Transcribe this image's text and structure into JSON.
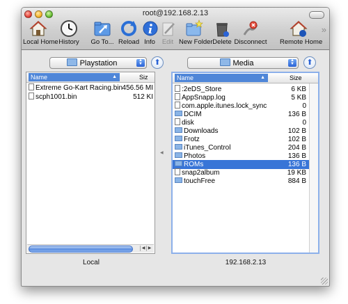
{
  "window": {
    "title": "root@192.168.2.13"
  },
  "toolbar": {
    "items": [
      {
        "label": "Local Home",
        "icon": "house-icon"
      },
      {
        "label": "History",
        "icon": "clock-icon"
      },
      {
        "label": "Go To...",
        "icon": "folder-goto-icon"
      },
      {
        "label": "Reload",
        "icon": "reload-icon"
      },
      {
        "label": "Info",
        "icon": "info-icon"
      },
      {
        "label": "Edit",
        "icon": "edit-icon"
      },
      {
        "label": "New Folder",
        "icon": "new-folder-icon"
      },
      {
        "label": "Delete",
        "icon": "trash-icon"
      },
      {
        "label": "Disconnect",
        "icon": "disconnect-icon"
      },
      {
        "label": "Remote Home",
        "icon": "remote-home-icon"
      }
    ],
    "overflow": "»"
  },
  "local": {
    "folder": "Playstation",
    "columns": {
      "name": "Name",
      "size": "Siz"
    },
    "rows": [
      {
        "name": "Extreme Go-Kart Racing.bin",
        "size": "456.56 MI"
      },
      {
        "name": "scph1001.bin",
        "size": "512 KI"
      }
    ],
    "status": "Local"
  },
  "remote": {
    "folder": "Media",
    "columns": {
      "name": "Name",
      "size": "Size"
    },
    "rows": [
      {
        "name": ":2eDS_Store",
        "size": "6 KB",
        "kind": "file"
      },
      {
        "name": "AppSnapp.log",
        "size": "5 KB",
        "kind": "file"
      },
      {
        "name": "com.apple.itunes.lock_sync",
        "size": "0",
        "kind": "file"
      },
      {
        "name": "DCIM",
        "size": "136 B",
        "kind": "folder"
      },
      {
        "name": "disk",
        "size": "0",
        "kind": "file"
      },
      {
        "name": "Downloads",
        "size": "102 B",
        "kind": "folder"
      },
      {
        "name": "Frotz",
        "size": "102 B",
        "kind": "folder"
      },
      {
        "name": "iTunes_Control",
        "size": "204 B",
        "kind": "folder"
      },
      {
        "name": "Photos",
        "size": "136 B",
        "kind": "folder"
      },
      {
        "name": "ROMs",
        "size": "136 B",
        "kind": "folder",
        "selected": true
      },
      {
        "name": "snap2album",
        "size": "19 KB",
        "kind": "file"
      },
      {
        "name": "touchFree",
        "size": "884 B",
        "kind": "folder"
      }
    ],
    "status": "192.168.2.13"
  },
  "colors": {
    "selection": "#3875d7",
    "accent": "#2a63d6"
  }
}
